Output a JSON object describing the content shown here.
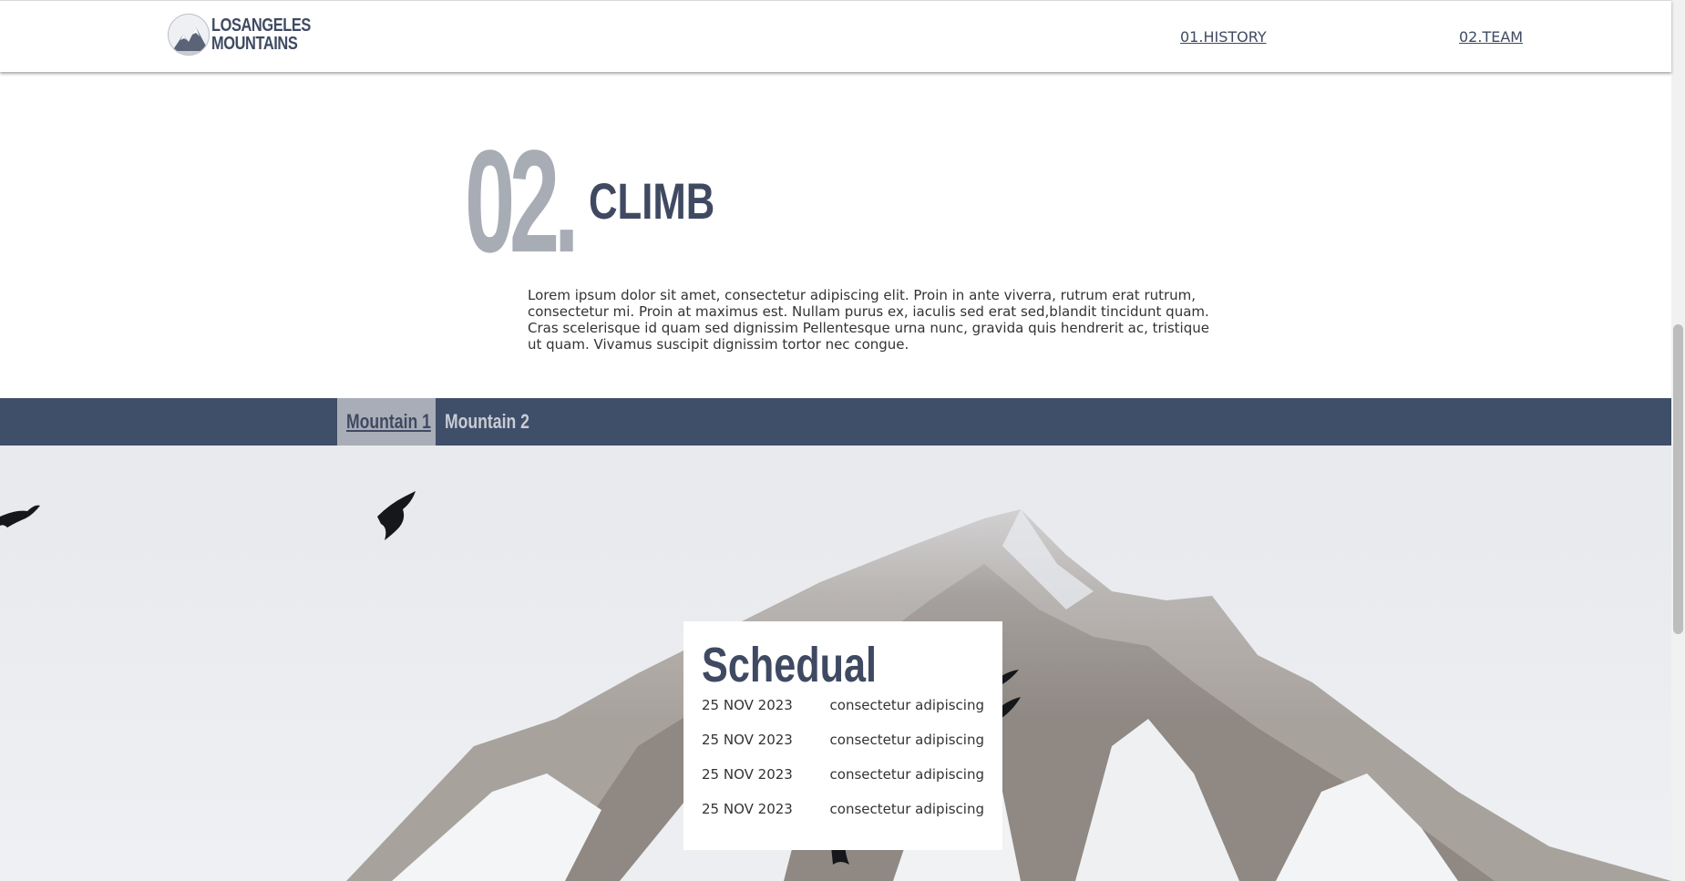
{
  "header": {
    "logo_line1": "LOSANGELES",
    "logo_line2": "MOUNTAINS",
    "nav": [
      {
        "label": "01.HISTORY"
      },
      {
        "label": "02.TEAM"
      }
    ]
  },
  "section": {
    "number": "02.",
    "title": "CLIMB",
    "body": "Lorem ipsum dolor sit amet, consectetur adipiscing elit. Proin in ante viverra, rutrum erat rutrum, consectetur mi. Proin at maximus est. Nullam purus ex, iaculis sed erat sed,blandit tincidunt quam. Cras scelerisque id quam sed dignissim Pellentesque urna nunc, gravida quis hendrerit ac, tristique ut quam. Vivamus suscipit dignissim tortor nec congue."
  },
  "tabs": [
    {
      "label": "Mountain 1",
      "active": true
    },
    {
      "label": "Mountain 2",
      "active": false
    }
  ],
  "schedule": {
    "title": "Schedual",
    "rows": [
      {
        "date": "25 NOV 2023",
        "text": "consectetur adipiscing"
      },
      {
        "date": "25 NOV 2023",
        "text": "consectetur adipiscing"
      },
      {
        "date": "25 NOV 2023",
        "text": "consectetur adipiscing"
      },
      {
        "date": "25 NOV 2023",
        "text": "consectetur adipiscing"
      }
    ]
  },
  "colors": {
    "brand_navy": "#3f4a62",
    "tabbar_bg": "#3f4e69",
    "active_tab_bg": "#a9adb7",
    "number_gray": "#a8acb5"
  }
}
